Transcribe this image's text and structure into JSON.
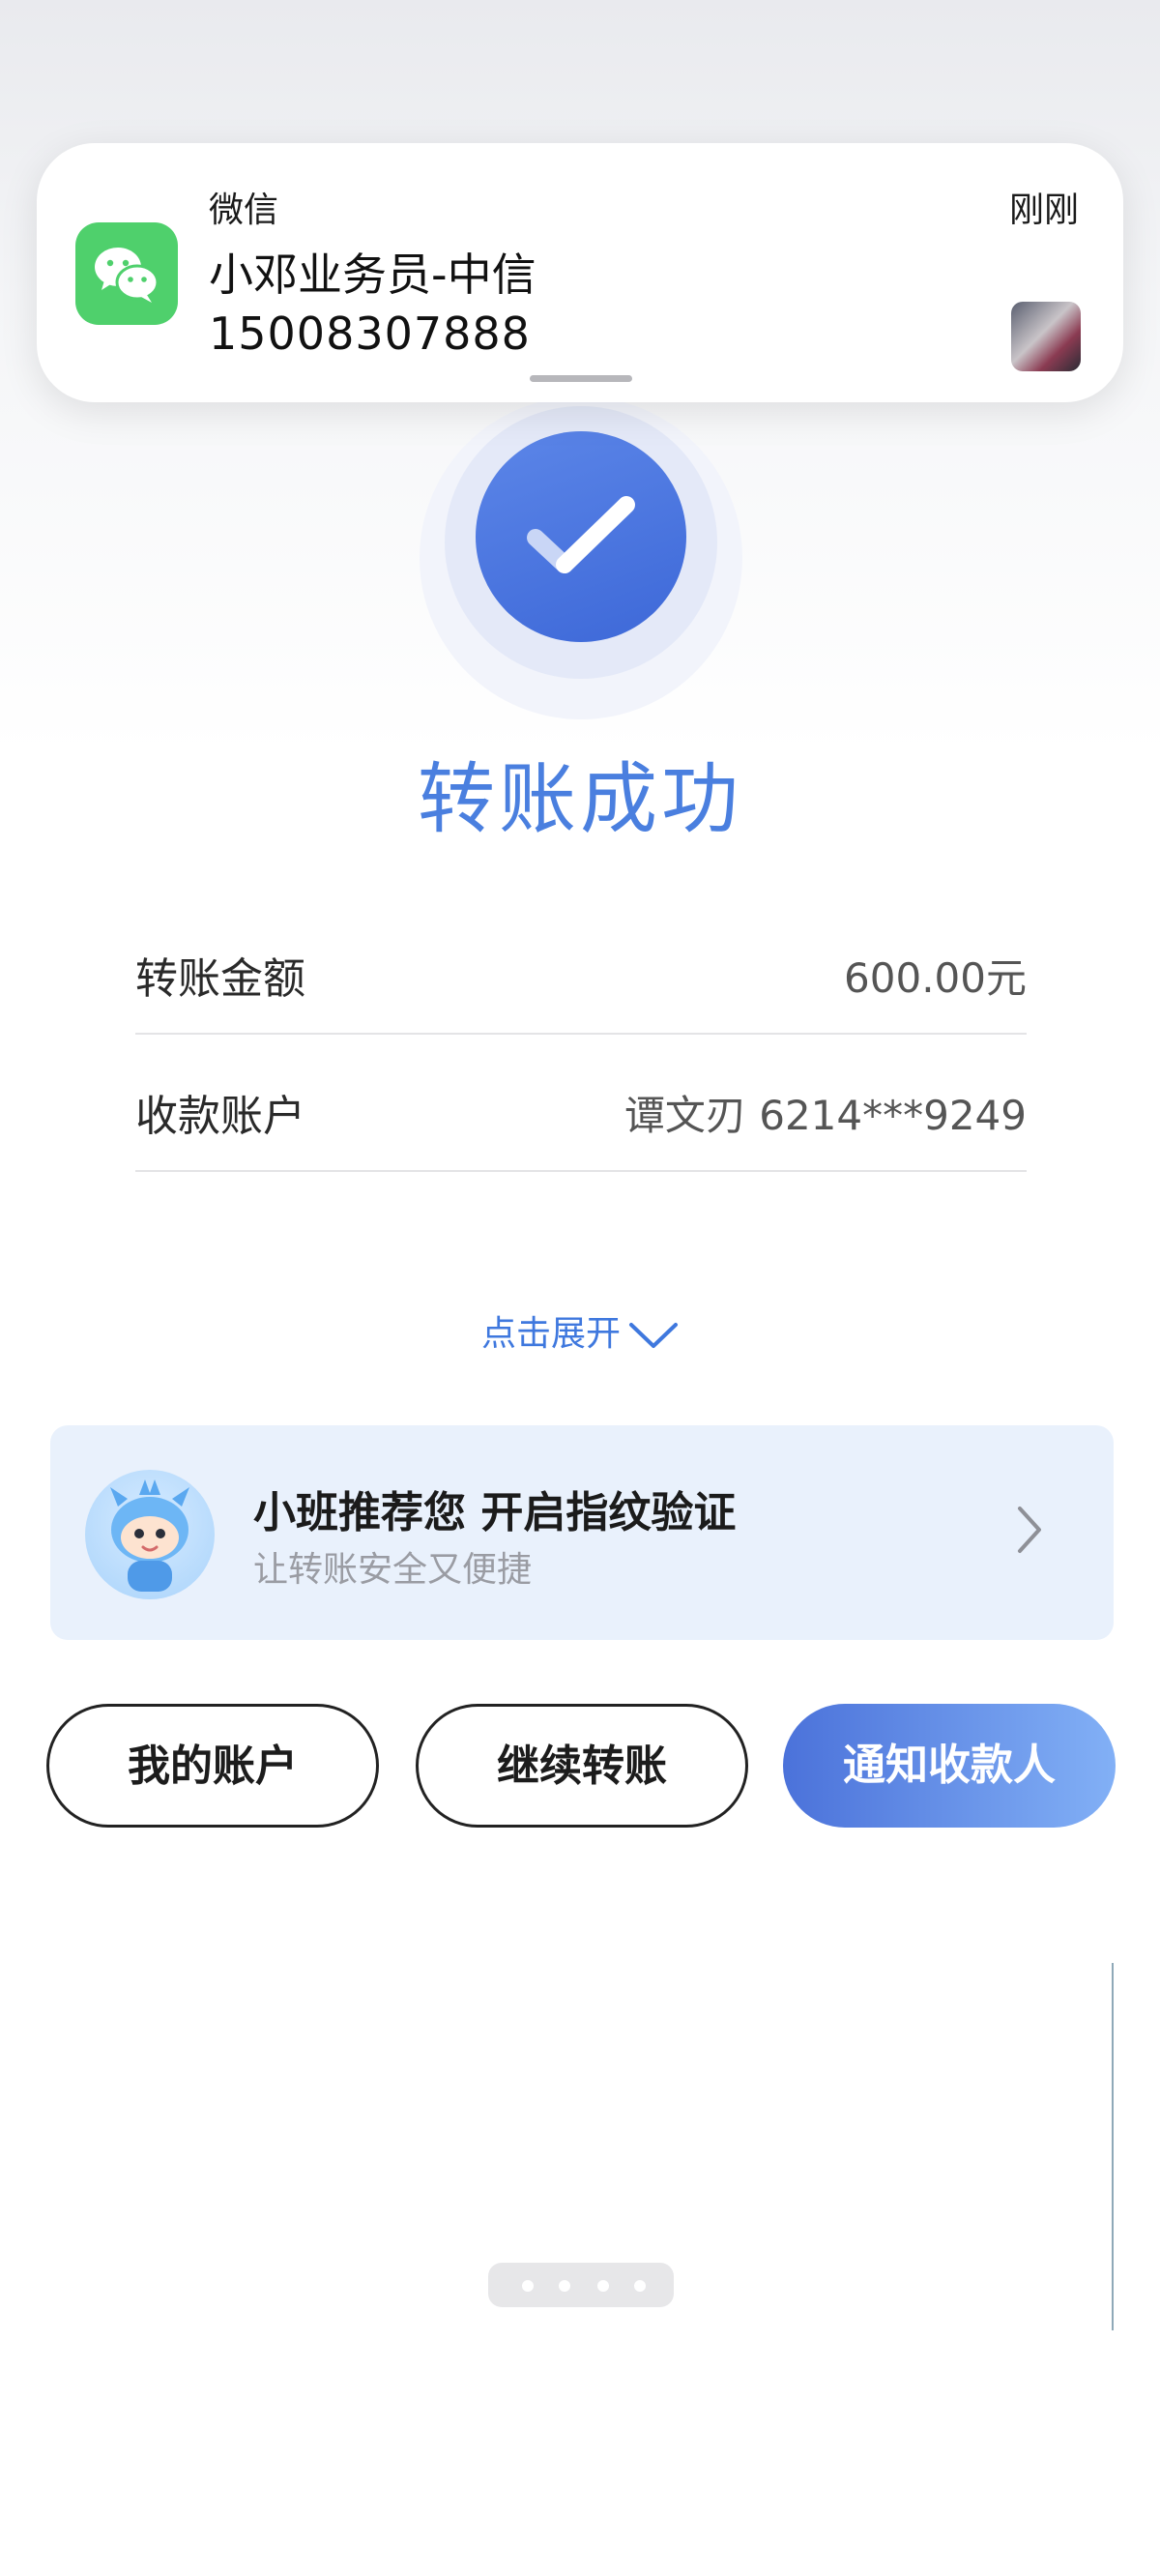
{
  "notification": {
    "app_name": "微信",
    "time": "刚刚",
    "title": "小邓业务员-中信",
    "body": "15008307888",
    "app_icon": "wechat-icon",
    "accent": "#4fd06c"
  },
  "result": {
    "title": "转账成功",
    "icon": "check-icon",
    "accent": "#4a7fdf"
  },
  "details": [
    {
      "label": "转账金额",
      "value": "600.00元"
    },
    {
      "label": "收款账户",
      "value": "谭文刃 6214***9249"
    }
  ],
  "expand_label": "点击展开",
  "promo": {
    "title": "小班推荐您 开启指纹验证",
    "subtitle": "让转账安全又便捷"
  },
  "actions": {
    "my_account": "我的账户",
    "continue_transfer": "继续转账",
    "notify_payee": "通知收款人"
  }
}
